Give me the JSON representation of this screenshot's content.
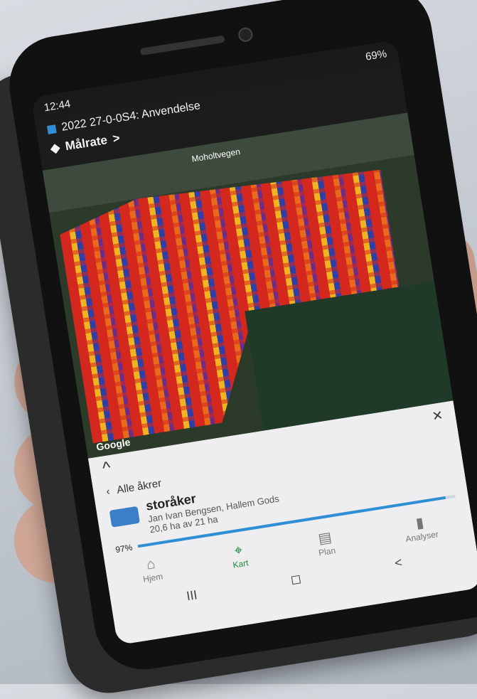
{
  "status_bar": {
    "time": "12:44",
    "battery": "69%"
  },
  "header": {
    "file_label": "2022 27-0-0S4: Anvendelse",
    "layer_label": "Målrate",
    "layer_chevron": ">"
  },
  "map": {
    "road_label": "Moholtvegen",
    "attribution": "Google"
  },
  "toolbar": {
    "icons": [
      "crosshair-icon",
      "gear-icon",
      "refresh-icon",
      "flag-add-icon",
      "polygon-icon"
    ]
  },
  "sheet": {
    "collapse_glyph": "^",
    "close_glyph": "×",
    "back_label": "Alle åkrer",
    "field_name": "storåker",
    "field_owner": "Jan Ivan Bengsen, Hallem Gods",
    "field_area": "20,6 ha av 21 ha",
    "progress_text": "97%",
    "progress_value": 0.97
  },
  "nav": [
    {
      "label": "Hjem",
      "icon": "home-icon"
    },
    {
      "label": "Kart",
      "icon": "map-pin-icon",
      "active": true
    },
    {
      "label": "Plan",
      "icon": "plan-icon"
    },
    {
      "label": "Analyser",
      "icon": "bar-chart-icon"
    }
  ],
  "system_nav": [
    "III",
    "◻",
    "<"
  ]
}
